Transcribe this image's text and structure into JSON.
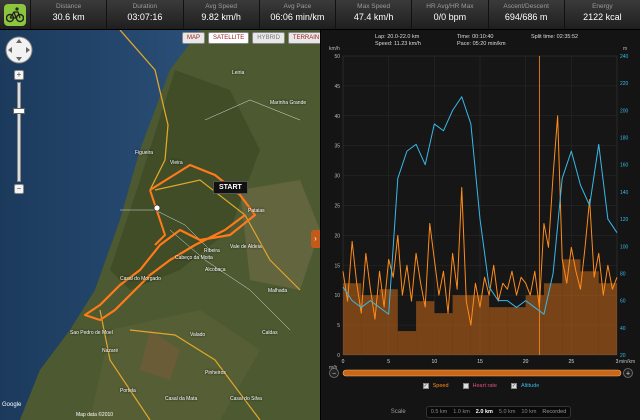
{
  "stats": [
    {
      "label": "Distance",
      "value": "30.6 km"
    },
    {
      "label": "Duration",
      "value": "03:07:16"
    },
    {
      "label": "Avg Speed",
      "value": "9.82 km/h"
    },
    {
      "label": "Avg Pace",
      "value": "06:06 min/km"
    },
    {
      "label": "Max Speed",
      "value": "47.4 km/h"
    },
    {
      "label": "HR Avg/HR Max",
      "value": "0/0 bpm"
    },
    {
      "label": "Ascent/Descent",
      "value": "694/686 m"
    },
    {
      "label": "Energy",
      "value": "2122 kcal"
    }
  ],
  "map": {
    "types": [
      "MAP",
      "SATELLITE",
      "HYBRID",
      "TERRAIN"
    ],
    "active_type": "SATELLITE",
    "start_label": "START",
    "google_label": "Google",
    "scale_label": "Map data ©2010",
    "places": [
      "Leiria",
      "Figueira",
      "Marinha Grande",
      "Sao Pedro de Moel",
      "Vieira",
      "Pataias",
      "Alcobaça",
      "Nazaré",
      "Valado",
      "Caldas",
      "Ribeira",
      "Vale de Aldeia",
      "Casal do Morgado",
      "Cabeço da Moita",
      "Malhada",
      "Portela",
      "Casal da Mata",
      "Casal do Silva",
      "Pinheiros"
    ],
    "zoom_plus": "+",
    "zoom_minus": "−",
    "collapse": "›",
    "accent": "#e8751a"
  },
  "info": {
    "lap": "Lap: 20.0-22.0 km",
    "speed": "Speed: 11.23 km/h",
    "time": "Time: 00:10:40",
    "pace": "Pace: 05:20 min/km",
    "split": "Split time: 02:35:52"
  },
  "chart_data": {
    "type": "line",
    "left_axis_label": "km/h",
    "right_axis_label": "m",
    "x_axis_label": "min/km",
    "bottom_left_label": "m/h",
    "left_ticks": [
      "50",
      "45",
      "40",
      "35",
      "30",
      "25",
      "20",
      "15",
      "10",
      "5",
      "0"
    ],
    "right_ticks": [
      "240",
      "220",
      "200",
      "180",
      "160",
      "140",
      "120",
      "100",
      "80",
      "60",
      "40",
      "20"
    ],
    "x_ticks": [
      "0",
      "5",
      "10",
      "15",
      "20",
      "25",
      "3"
    ],
    "ylim_left": [
      0,
      50
    ],
    "ylim_right": [
      20,
      240
    ],
    "xlim": [
      0,
      30
    ],
    "split_marker_km": 21.5,
    "colors": {
      "speed": "#ff8c1a",
      "altitude": "#3ab8e8",
      "bars": "#c86a1a"
    },
    "series": [
      {
        "name": "Speed",
        "color": "#ff8c1a",
        "x": [
          0,
          0.5,
          1,
          1.5,
          2,
          2.5,
          3,
          3.5,
          4,
          4.5,
          5,
          5.5,
          6,
          6.5,
          7,
          7.5,
          8,
          8.5,
          9,
          9.5,
          10,
          10.5,
          11,
          11.5,
          12,
          12.5,
          13,
          13.5,
          14,
          14.5,
          15,
          15.5,
          16,
          16.5,
          17,
          17.5,
          18,
          18.5,
          19,
          19.5,
          20,
          20.5,
          21,
          21.5,
          22,
          22.5,
          23,
          23.5,
          24,
          24.5,
          25,
          25.5,
          26,
          26.5,
          27,
          27.5,
          28,
          28.5,
          29,
          29.5,
          30
        ],
        "values": [
          14,
          9,
          19,
          12,
          7,
          17,
          11,
          6,
          14,
          8,
          16,
          13,
          20,
          10,
          15,
          9,
          17,
          12,
          8,
          22,
          16,
          10,
          14,
          7,
          17,
          11,
          28,
          9,
          5,
          12,
          8,
          13,
          10,
          15,
          9,
          12,
          11,
          14,
          10,
          13,
          12,
          10,
          14,
          8,
          22,
          18,
          30,
          40,
          16,
          12,
          18,
          14,
          11,
          18,
          26,
          13,
          17,
          10,
          15,
          11,
          13
        ]
      },
      {
        "name": "Altitude",
        "color": "#3ab8e8",
        "x": [
          0,
          1,
          2,
          3,
          4,
          5,
          6,
          7,
          8,
          9,
          10,
          11,
          12,
          13,
          14,
          15,
          16,
          17,
          18,
          19,
          20,
          21,
          22,
          23,
          24,
          25,
          26,
          27,
          28,
          29,
          30
        ],
        "values": [
          70,
          60,
          55,
          60,
          55,
          50,
          150,
          170,
          175,
          160,
          190,
          185,
          200,
          210,
          190,
          120,
          70,
          60,
          60,
          55,
          60,
          55,
          50,
          80,
          150,
          170,
          145,
          130,
          175,
          120,
          110
        ]
      },
      {
        "name": "Heart rate",
        "color": "#e0507a",
        "x": [],
        "values": []
      }
    ],
    "laps": {
      "x_start": [
        0,
        2,
        4,
        6,
        8,
        10,
        12,
        14,
        16,
        18,
        20,
        22,
        24,
        26,
        28
      ],
      "values": [
        12,
        10,
        11,
        4,
        9,
        7,
        10,
        10,
        8,
        8,
        10,
        12,
        16,
        14,
        12
      ]
    }
  },
  "legend": [
    {
      "label": "Speed",
      "color": "#ff8c1a",
      "checked": true,
      "check": "✓"
    },
    {
      "label": "Heart rate",
      "color": "#e0507a",
      "checked": false,
      "check": ""
    },
    {
      "label": "Altitude",
      "color": "#3ab8e8",
      "checked": true,
      "check": "✓"
    }
  ],
  "scale": {
    "label": "Scale",
    "options": [
      "0.5 km",
      "1.0 km",
      "2.0 km",
      "5.0 km",
      "10 km",
      "Recorded"
    ],
    "active": "2.0 km"
  }
}
